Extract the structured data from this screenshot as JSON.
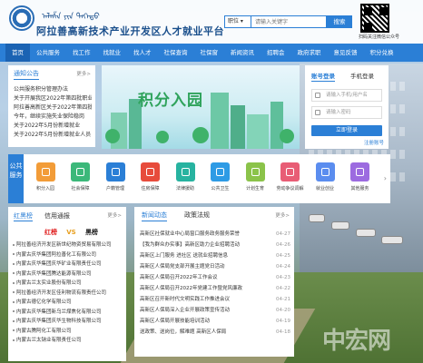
{
  "header": {
    "mongolian_script": "ᠠᠯᠠᠱᠠ ᠶᠢᠨ ᠳᠡᠭᠡᠳᠦ",
    "site_title": "阿拉善高新技术产业开发区人才就业平台",
    "search_select": "职位",
    "search_placeholder": "请输入关键字",
    "search_button": "搜索",
    "qr_caption": "扫码关注微信公众号"
  },
  "nav": [
    "首页",
    "公共服务",
    "找工作",
    "找就业",
    "找人才",
    "社保查询",
    "社保窗",
    "新闻资讯",
    "招聘会",
    "政府求职",
    "意见反馈",
    "积分兑换"
  ],
  "nav_active": 0,
  "notices": {
    "tab": "通知公告",
    "more": "更多>",
    "items": [
      "公共服务积分管理办法",
      "关于开展我区2022年第四批职业",
      "阿拉善高新区关于2022年第四批",
      "今年，继续实施失业保险稳岗",
      "关于2022年5月份新增就业",
      "关于2022年5月份新增就业人员"
    ]
  },
  "banner": {
    "title": "积分入园"
  },
  "login": {
    "tab_account": "账号登录",
    "tab_phone": "手机登录",
    "account_placeholder": "请输入手机/用户名",
    "password_placeholder": "请输入密码",
    "login_button": "立即登录",
    "register": "注册账号"
  },
  "services": {
    "label": "公共服务",
    "items": [
      {
        "label": "积分入园",
        "color": "#f29c38"
      },
      {
        "label": "社会保障",
        "color": "#3cb87a"
      },
      {
        "label": "户籍管理",
        "color": "#2b7fd6"
      },
      {
        "label": "住房保障",
        "color": "#e74c3c"
      },
      {
        "label": "法律援助",
        "color": "#27b3a0"
      },
      {
        "label": "公共卫生",
        "color": "#2e9be5"
      },
      {
        "label": "计划生育",
        "color": "#8bc34a"
      },
      {
        "label": "劳动争议调解",
        "color": "#e85d75"
      },
      {
        "label": "就业创业",
        "color": "#5b8def"
      },
      {
        "label": "其他服务",
        "color": "#9c6be0"
      }
    ]
  },
  "redblack": {
    "tab1": "红黑榜",
    "tab2": "信用通报",
    "more": "更多>",
    "red": "红榜",
    "vs": "VS",
    "black": "黑榜",
    "items": [
      "阿拉善经济开发区新世纪物资贸易有限公司",
      "内蒙古庆华集团阿拉善化工有限公司",
      "内蒙古庆华集团庆华矿业有限责任公司",
      "内蒙古庆华集团腾达能源有限公司",
      "内蒙古兰太实业股份有限公司",
      "阿拉善经济开发区佳利物流有限责任公司",
      "内蒙古德亿化学有限公司",
      "内蒙古庆华集团新乌兰煤焦化有限公司",
      "内蒙古庆华集团庆华生物科技有限公司",
      "内蒙古腾阿化工有限公司",
      "内蒙古兰太钠业有限责任公司"
    ]
  },
  "news": {
    "tab1": "新闻动态",
    "tab2": "政策法规",
    "more": "更多>",
    "items": [
      {
        "title": "高新区社保就业中心局窗口服务政务服务荣誉",
        "date": "04-27"
      },
      {
        "title": "【我为群众办实事】高新区助力企业招聘活动",
        "date": "04-26"
      },
      {
        "title": "高新区上门服务 进社区 送就业招聘信息",
        "date": "04-25"
      },
      {
        "title": "高新区人保局党支部开展主题党日活动",
        "date": "04-24"
      },
      {
        "title": "高新区人保局召开2022年工作会议",
        "date": "04-23"
      },
      {
        "title": "高新区人保局召开2022年党建工作暨党风廉政",
        "date": "04-22"
      },
      {
        "title": "高新区召开新时代文明实践工作推进会议",
        "date": "04-21"
      },
      {
        "title": "高新区人保局深入企业开展政策宣传活动",
        "date": "04-20"
      },
      {
        "title": "高新区人保局开展技能培训活动",
        "date": "04-19"
      },
      {
        "title": "送政策、送岗位，解难题 高新区人保局",
        "date": "04-18"
      }
    ]
  },
  "watermark": "中宏网"
}
